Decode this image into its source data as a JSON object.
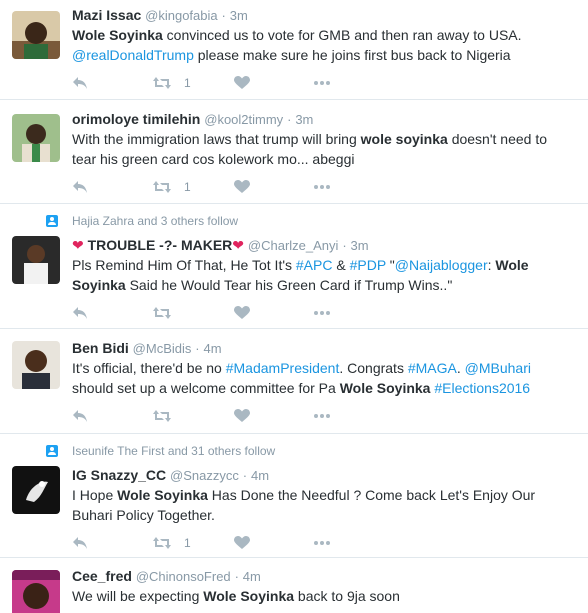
{
  "tweets": [
    {
      "fullname": "Mazi Issac",
      "username": "@kingofabia",
      "sep": "·",
      "time": "3m",
      "retweets": "1",
      "lines": [
        [
          {
            "t": "Wole Soyinka",
            "b": true
          },
          {
            "t": " convinced us to vote for GMB and then ran away to USA."
          }
        ],
        [
          {
            "t": "@realDonaldTrump",
            "l": true
          },
          {
            "t": " please make sure he joins first bus back to Nigeria"
          }
        ]
      ]
    },
    {
      "fullname": "orimoloye timilehin",
      "username": "@kool2timmy",
      "sep": "·",
      "time": "3m",
      "retweets": "1",
      "lines": [
        [
          {
            "t": "With the immigration laws that trump will bring "
          },
          {
            "t": "wole soyinka",
            "b": true
          },
          {
            "t": " doesn't need to"
          }
        ],
        [
          {
            "t": "tear his green card cos kolework mo... abeggi"
          }
        ]
      ]
    },
    {
      "social": "Hajia Zahra and 3 others follow",
      "heart_left": "❤",
      "fullname": "TROUBLE -?- MAKER",
      "heart_right": "❤",
      "username": "@Charlze_Anyi",
      "sep": "·",
      "time": "3m",
      "retweets": "",
      "lines": [
        [
          {
            "t": "Pls Remind Him Of That, He Tot It's "
          },
          {
            "t": "#APC",
            "l": true
          },
          {
            "t": " & "
          },
          {
            "t": "#PDP",
            "l": true
          },
          {
            "t": " \""
          },
          {
            "t": "@Naijablogger",
            "l": true
          },
          {
            "t": ": "
          },
          {
            "t": "Wole",
            "b": true
          }
        ],
        [
          {
            "t": "Soyinka",
            "b": true
          },
          {
            "t": " Said he Would Tear his Green Card if Trump Wins..\""
          }
        ]
      ]
    },
    {
      "fullname": "Ben Bidi",
      "username": "@McBidis",
      "sep": "·",
      "time": "4m",
      "retweets": "",
      "lines": [
        [
          {
            "t": "It's official, there'd be no "
          },
          {
            "t": "#MadamPresident",
            "l": true
          },
          {
            "t": ". Congrats "
          },
          {
            "t": "#MAGA",
            "l": true
          },
          {
            "t": ". "
          },
          {
            "t": "@MBuhari",
            "l": true
          }
        ],
        [
          {
            "t": "should set up a welcome committee for Pa "
          },
          {
            "t": "Wole Soyinka",
            "b": true
          },
          {
            "t": " "
          },
          {
            "t": "#Elections2016",
            "l": true
          }
        ]
      ]
    },
    {
      "social": "Iseunife The First and 31 others follow",
      "fullname": "IG Snazzy_CC",
      "username": "@Snazzycc",
      "sep": "·",
      "time": "4m",
      "retweets": "1",
      "lines": [
        [
          {
            "t": "I Hope "
          },
          {
            "t": "Wole Soyinka",
            "b": true
          },
          {
            "t": " Has Done the Needful ? Come back Let's Enjoy Our"
          }
        ],
        [
          {
            "t": "Buhari Policy Together."
          }
        ]
      ]
    },
    {
      "fullname": "Cee_fred",
      "username": "@ChinonsoFred",
      "sep": "·",
      "time": "4m",
      "retweets": "",
      "lines": [
        [
          {
            "t": "We will be expecting "
          },
          {
            "t": "Wole Soyinka",
            "b": true
          },
          {
            "t": " back to 9ja soon"
          }
        ]
      ]
    }
  ]
}
